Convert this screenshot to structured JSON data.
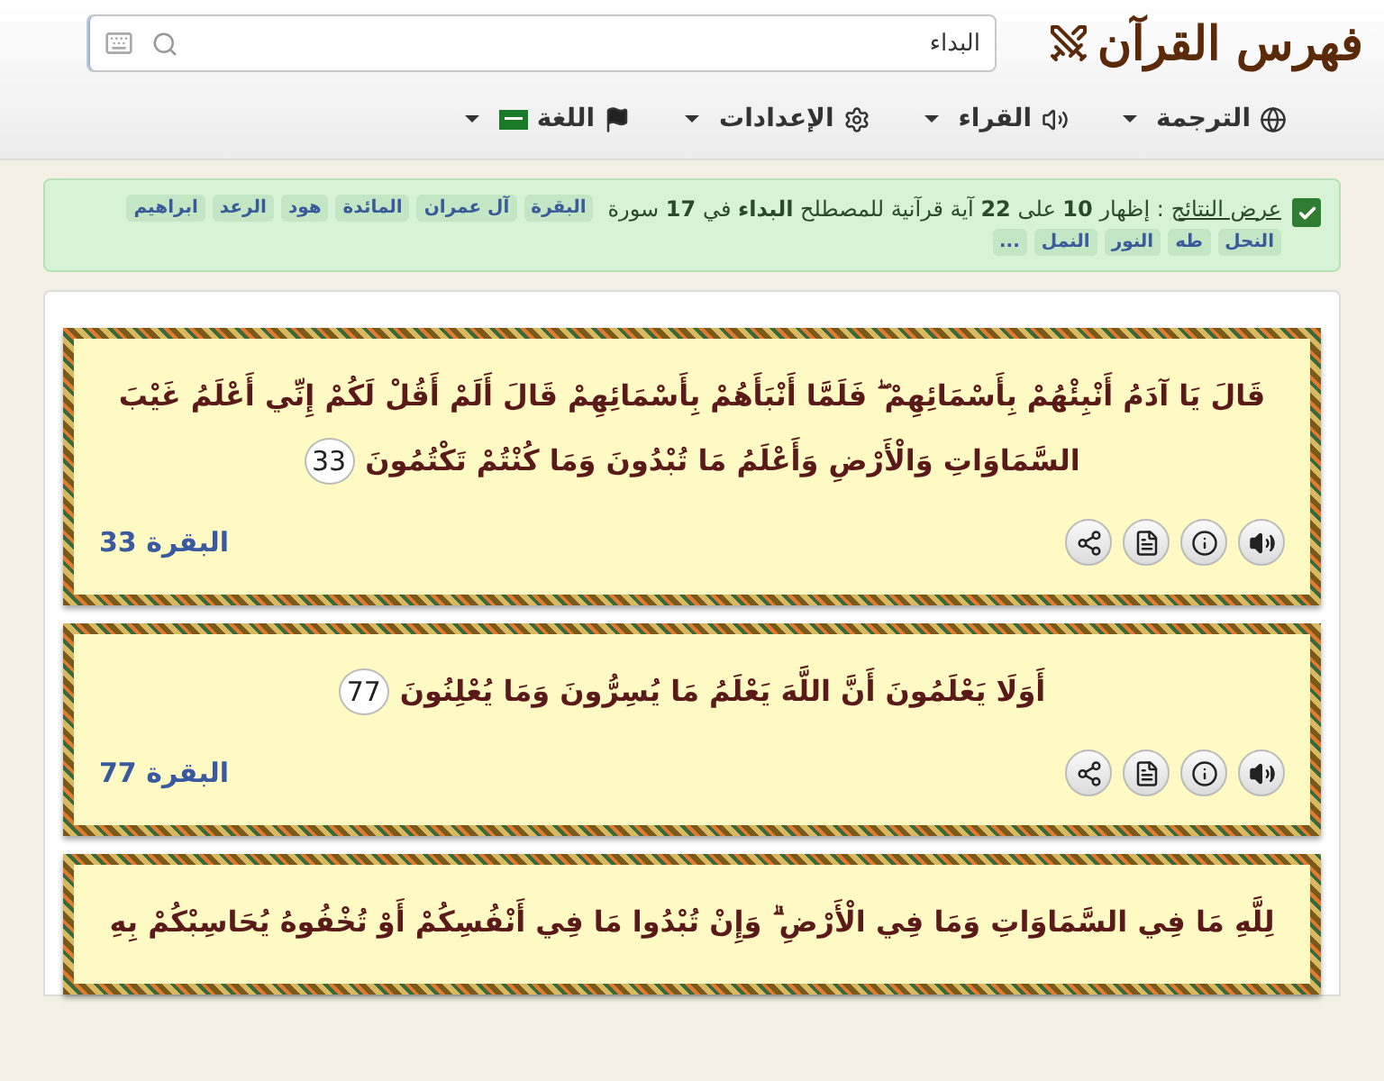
{
  "header": {
    "logo": "فهرس القرآن",
    "search": {
      "value": "البداء"
    }
  },
  "nav": [
    {
      "label": "الترجمة",
      "kind": "globe"
    },
    {
      "label": "القراء",
      "kind": "speaker"
    },
    {
      "label": "الإعدادات",
      "kind": "gear"
    },
    {
      "label": "اللغة",
      "kind": "flag"
    }
  ],
  "results": {
    "checked": true,
    "label": "عرض النتائج",
    "summary": ": إظهار **10** على **22** آية قرآنية للمصطلح **البداء** في **17** سورة",
    "tags": [
      "البقرة",
      "آل عمران",
      "المائدة",
      "هود",
      "الرعد",
      "ابراهيم",
      "النحل",
      "طه",
      "النور",
      "النمل",
      "..."
    ]
  },
  "verses": [
    {
      "text": "قَالَ يَا آدَمُ أَنْبِئْهُمْ بِأَسْمَائِهِمْ ۖ فَلَمَّا أَنْبَأَهُمْ بِأَسْمَائِهِمْ قَالَ أَلَمْ أَقُلْ لَكُمْ إِنِّي أَعْلَمُ غَيْبَ السَّمَاوَاتِ وَالْأَرْضِ وَأَعْلَمُ مَا تُبْدُونَ وَمَا كُنْتُمْ تَكْتُمُونَ",
      "number": "33",
      "reference": "البقرة 33"
    },
    {
      "text": "أَوَلَا يَعْلَمُونَ أَنَّ اللَّهَ يَعْلَمُ مَا يُسِرُّونَ وَمَا يُعْلِنُونَ",
      "number": "77",
      "reference": "البقرة 77"
    },
    {
      "text": "لِلَّهِ مَا فِي السَّمَاوَاتِ وَمَا فِي الْأَرْضِ ۗ وَإِنْ تُبْدُوا مَا فِي أَنْفُسِكُمْ أَوْ تُخْفُوهُ يُحَاسِبْكُمْ بِهِ"
    }
  ]
}
